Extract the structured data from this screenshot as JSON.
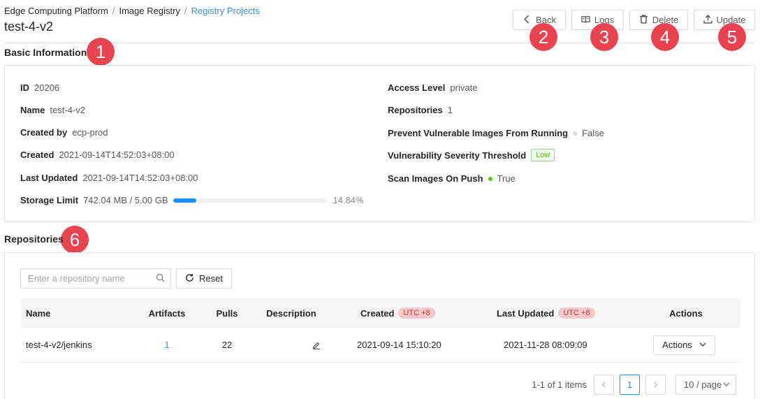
{
  "breadcrumb": {
    "items": [
      "Edge Computing Platform",
      "Image Registry",
      "Registry Projects"
    ],
    "separator": "/"
  },
  "page_title": "test-4-v2",
  "toolbar": {
    "back_label": "Back",
    "logs_label": "Logs",
    "delete_label": "Delete",
    "update_label": "Update"
  },
  "markers": [
    "1",
    "2",
    "3",
    "4",
    "5",
    "6"
  ],
  "basic_info": {
    "title": "Basic Information",
    "id_label": "ID",
    "id_value": "20206",
    "name_label": "Name",
    "name_value": "test-4-v2",
    "created_by_label": "Created by",
    "created_by_value": "ecp-prod",
    "created_label": "Created",
    "created_value": "2021-09-14T14:52:03+08:00",
    "last_updated_label": "Last Updated",
    "last_updated_value": "2021-09-14T14:52:03+08:00",
    "storage_label": "Storage Limit",
    "storage_value": "742.04 MB / 5.00 GB",
    "storage_percent_text": "14.84%",
    "storage_fraction": 0.1484,
    "access_level_label": "Access Level",
    "access_level_value": "private",
    "repositories_label": "Repositories",
    "repositories_value": "1",
    "prevent_label": "Prevent Vulnerable Images From Running",
    "prevent_value": "False",
    "threshold_label": "Vulnerability Severity Threshold",
    "threshold_value": "Low",
    "scan_label": "Scan Images On Push",
    "scan_value": "True"
  },
  "colors": {
    "accent": "#1890ff",
    "link": "#3a8be0",
    "marker": "#e8434f",
    "status_true": "#52c41a",
    "status_false": "#d9d9d9"
  },
  "repositories": {
    "title": "Repositories",
    "search_placeholder": "Enter a repository name",
    "reset_label": "Reset",
    "columns": {
      "name": "Name",
      "artifacts": "Artifacts",
      "pulls": "Pulls",
      "description": "Description",
      "created": "Created",
      "last_updated": "Last Updated",
      "actions": "Actions",
      "utc_badge": "UTC +8"
    },
    "rows": [
      {
        "name": "test-4-v2/jenkins",
        "artifacts": "1",
        "pulls": "22",
        "created": "2021-09-14 15:10:20",
        "last_updated": "2021-11-28 08:09:09",
        "actions_label": "Actions"
      }
    ],
    "pagination": {
      "summary": "1-1 of 1 items",
      "current_page": "1",
      "page_size": "10 / page"
    }
  }
}
